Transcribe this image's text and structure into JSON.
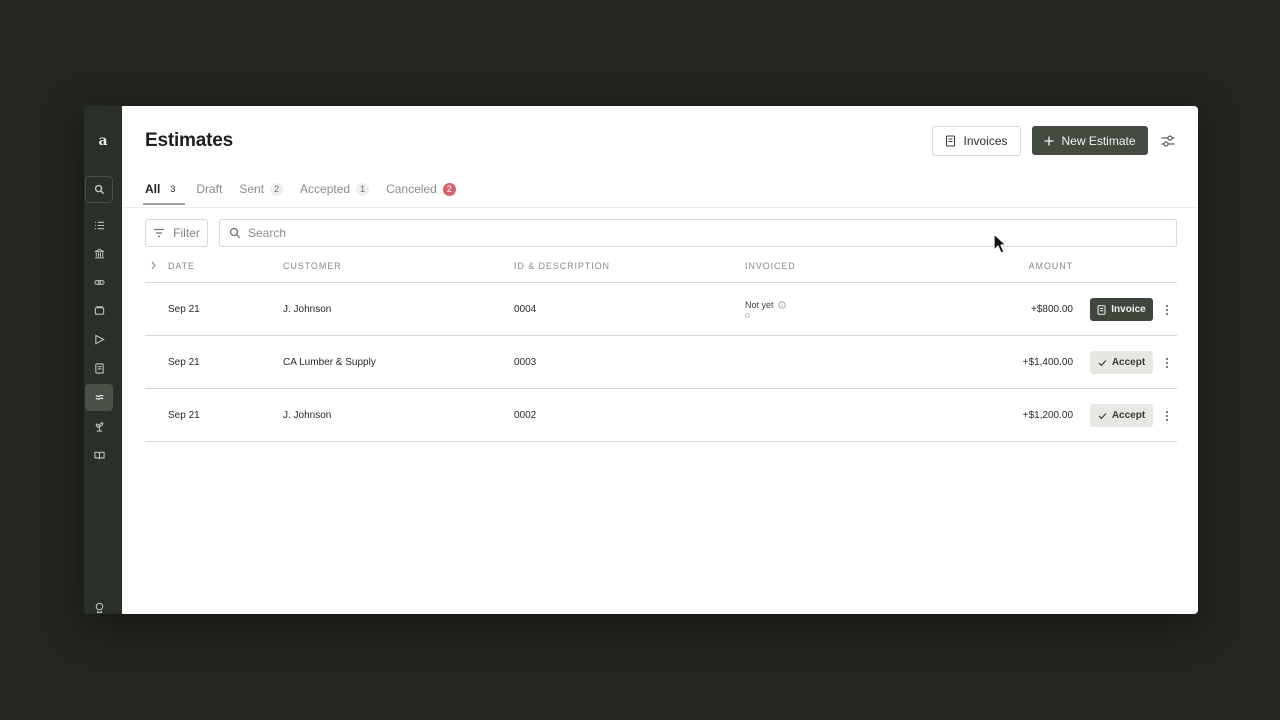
{
  "sidebar": {
    "logo": "a",
    "items": [
      {
        "icon": "search-icon",
        "name": "sidebar-item-search"
      },
      {
        "icon": "list-icon",
        "name": "sidebar-item-tasks"
      },
      {
        "icon": "bank-icon",
        "name": "sidebar-item-banking"
      },
      {
        "icon": "link-icon",
        "name": "sidebar-item-links"
      },
      {
        "icon": "wallet-icon",
        "name": "sidebar-item-wallet"
      },
      {
        "icon": "send-icon",
        "name": "sidebar-item-send"
      },
      {
        "icon": "document-icon",
        "name": "sidebar-item-invoices"
      },
      {
        "icon": "estimates-icon",
        "name": "sidebar-item-estimates",
        "active": true
      },
      {
        "icon": "plant-icon",
        "name": "sidebar-item-growth"
      },
      {
        "icon": "book-icon",
        "name": "sidebar-item-library"
      }
    ],
    "bottom_icon": "help-icon"
  },
  "header": {
    "title": "Estimates",
    "invoices_label": "Invoices",
    "new_estimate_label": "New Estimate"
  },
  "tabs": [
    {
      "label": "All",
      "count": "3",
      "active": true
    },
    {
      "label": "Draft",
      "count": ""
    },
    {
      "label": "Sent",
      "count": "2"
    },
    {
      "label": "Accepted",
      "count": "1"
    },
    {
      "label": "Canceled",
      "count": "2",
      "alert": true
    }
  ],
  "filter": {
    "label": "Filter"
  },
  "search": {
    "placeholder": "Search",
    "value": ""
  },
  "table": {
    "columns": {
      "date": "DATE",
      "customer": "CUSTOMER",
      "id_description": "ID & DESCRIPTION",
      "invoiced": "INVOICED",
      "amount": "AMOUNT"
    },
    "rows": [
      {
        "date": "Sep 21",
        "customer": "J. Johnson",
        "id": "0004",
        "invoiced": "Not yet",
        "amount": "+$800.00",
        "action": "Invoice",
        "action_style": "dark"
      },
      {
        "date": "Sep 21",
        "customer": "CA Lumber & Supply",
        "id": "0003",
        "invoiced": "",
        "amount": "+$1,400.00",
        "action": "Accept",
        "action_style": "light"
      },
      {
        "date": "Sep 21",
        "customer": "J. Johnson",
        "id": "0002",
        "invoiced": "",
        "amount": "+$1,200.00",
        "action": "Accept",
        "action_style": "light"
      }
    ]
  },
  "colors": {
    "background": "#23271f",
    "sidebar": "#2b2f29",
    "primary_button": "#444b41",
    "alert_badge": "#d9606a"
  }
}
